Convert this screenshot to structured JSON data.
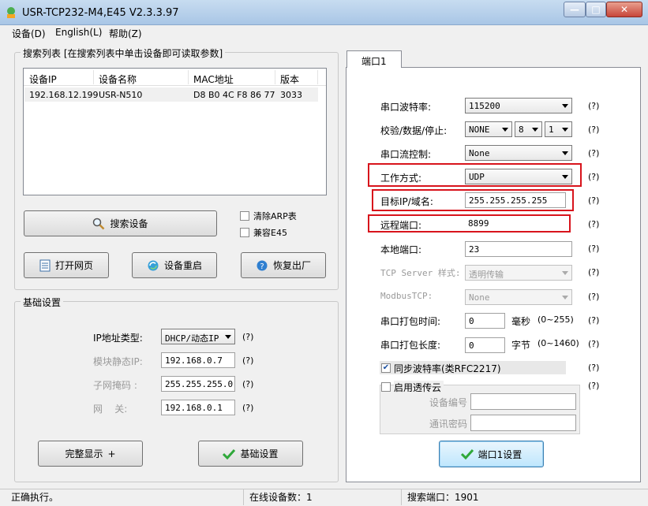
{
  "window": {
    "title": "USR-TCP232-M4,E45 V2.3.3.97",
    "min": "—",
    "max": "□",
    "close": "✕"
  },
  "menu": [
    "设备(D)",
    "English(L)",
    "帮助(Z)"
  ],
  "search": {
    "group_title": "搜索列表 [在搜索列表中单击设备即可读取参数]",
    "columns": [
      "设备IP",
      "设备名称",
      "MAC地址",
      "版本"
    ],
    "rows": [
      [
        "192.168.12.199",
        "USR-N510",
        "D8 B0 4C F8 86 77",
        "3033"
      ]
    ],
    "search_button": "搜索设备",
    "clear_arp": "清除ARP表",
    "compat_e45": "兼容E45",
    "open_web": "打开网页",
    "restart": "设备重启",
    "factory_reset": "恢复出厂"
  },
  "basic": {
    "group_title": "基础设置",
    "ip_type_label": "IP地址类型:",
    "ip_type_value": "DHCP/动态IP",
    "static_ip_label": "模块静态IP:",
    "static_ip_value": "192.168.0.7",
    "mask_label": "子网掩码 :",
    "mask_value": "255.255.255.0",
    "gateway_label": "网    关:",
    "gateway_value": "192.168.0.1",
    "help": "(?)",
    "full_display": "完整显示",
    "full_display_plus": "+",
    "basic_settings_button": "基础设置"
  },
  "port": {
    "tab": "端口1",
    "baud_label": "串口波特率:",
    "baud_value": "115200",
    "parity_label": "校验/数据/停止:",
    "parity_value": "NONE",
    "data_value": "8",
    "stop_value": "1",
    "flow_label": "串口流控制:",
    "flow_value": "None",
    "mode_label": "工作方式:",
    "mode_value": "UDP",
    "target_label": "目标IP/域名:",
    "target_value": "255.255.255.255",
    "remote_port_label": "远程端口:",
    "remote_port_value": "8899",
    "local_port_label": "本地端口:",
    "local_port_value": "23",
    "tcp_server_label": "TCP Server 样式:",
    "tcp_server_value": "透明传输",
    "modbus_label": "ModbusTCP:",
    "modbus_value": "None",
    "pack_time_label": "串口打包时间:",
    "pack_time_value": "0",
    "pack_time_unit": "毫秒",
    "pack_time_range": "(0~255)",
    "pack_len_label": "串口打包长度:",
    "pack_len_value": "0",
    "pack_len_unit": "字节",
    "pack_len_range": "(0~1460)",
    "sync_baud": "同步波特率(类RFC2217)",
    "cloud": "启用透传云",
    "device_no_label": "设备编号",
    "comm_pwd_label": "通讯密码",
    "help": "(?)",
    "save_button": "端口1设置"
  },
  "status": {
    "message": "正确执行。",
    "online": "在线设备数：1",
    "search_port": "搜索端口：1901"
  },
  "colors": {
    "highlight": "#d8141c",
    "titlebar": "#b9d1ea"
  }
}
